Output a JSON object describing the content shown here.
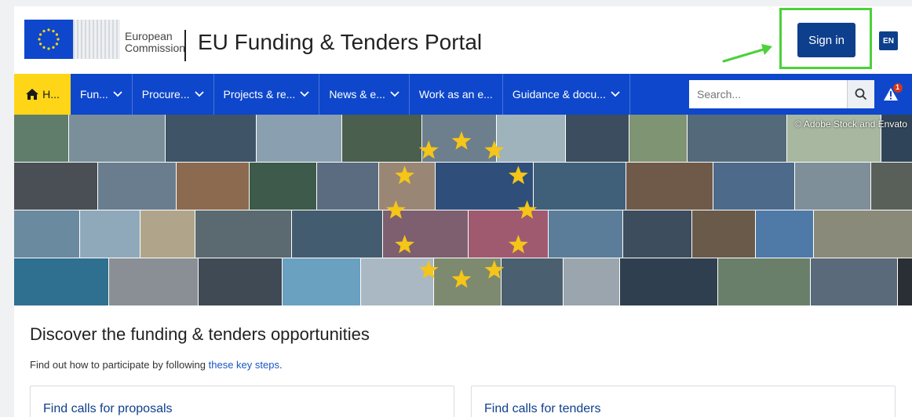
{
  "header": {
    "logo_line1": "European",
    "logo_line2": "Commission",
    "portal_title": "EU Funding & Tenders Portal",
    "signin_label": "Sign in",
    "language": "EN"
  },
  "nav": {
    "home_label": "H...",
    "items": [
      {
        "label": "Fun...",
        "chevron": true
      },
      {
        "label": "Procure...",
        "chevron": true
      },
      {
        "label": "Projects & re...",
        "chevron": true
      },
      {
        "label": "News & e...",
        "chevron": true
      },
      {
        "label": "Work as an e...",
        "chevron": false
      },
      {
        "label": "Guidance & docu...",
        "chevron": true
      }
    ],
    "search_placeholder": "Search...",
    "notification_count": "1"
  },
  "hero": {
    "credit": "© Adobe Stock and Envato"
  },
  "content": {
    "title": "Discover the funding & tenders opportunities",
    "subtitle_prefix": "Find out how to participate by following ",
    "subtitle_link": "these key steps",
    "subtitle_suffix": "."
  },
  "cards": {
    "proposals": "Find calls for proposals",
    "tenders": "Find calls for tenders"
  },
  "colors": {
    "brand_blue": "#0e47cb",
    "button_blue": "#0e3f8c",
    "home_yellow": "#ffd617",
    "highlight_green": "#4cd13a",
    "star_yellow": "#f5c518"
  }
}
